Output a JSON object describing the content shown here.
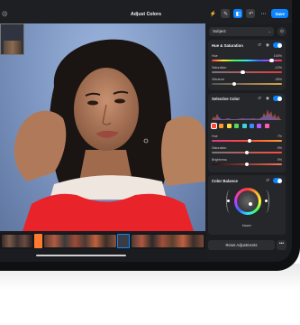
{
  "app": {
    "title": "Adjust Colors",
    "save_label": "Save"
  },
  "toolbar": {
    "left_icon": "sidebar-toggle-icon",
    "icons": [
      "magic-wand-icon",
      "brush-icon",
      "layers-icon",
      "undo-icon",
      "more-icon"
    ],
    "accent": "#0a84ff"
  },
  "panel": {
    "subject_dropdown": "Subject",
    "hue_saturation": {
      "title": "Hue & Saturation",
      "sliders": [
        {
          "label": "Hue",
          "value": "100%",
          "fraction": 0.85
        },
        {
          "label": "Saturation",
          "value": "-12%",
          "fraction": 0.44
        },
        {
          "label": "Vibrance",
          "value": "-36%",
          "fraction": 0.32
        }
      ]
    },
    "selective_color": {
      "title": "Selective Color",
      "swatches": [
        "#ff4a3a",
        "#ff9a2e",
        "#ffd93a",
        "#58d65a",
        "#3ad6d6",
        "#3a8bff",
        "#b05aff",
        "#ff5ab0"
      ],
      "selected_swatch": 0,
      "sliders": [
        {
          "label": "Hue",
          "value": "7%",
          "fraction": 0.54
        },
        {
          "label": "Saturation",
          "value": "0%",
          "fraction": 0.5
        },
        {
          "label": "Brightness",
          "value": "0%",
          "fraction": 0.5
        }
      ]
    },
    "color_balance": {
      "title": "Color Balance",
      "wheel_label": "Master"
    },
    "reset_label": "Reset Adjustments",
    "more_label": "•••"
  }
}
